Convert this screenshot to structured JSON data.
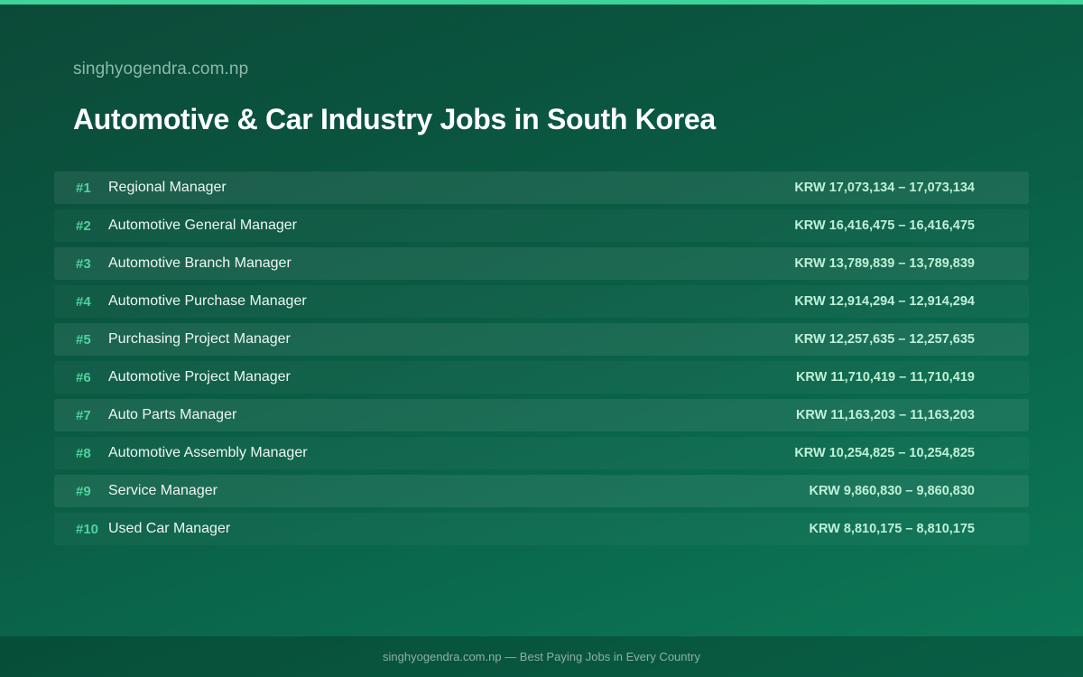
{
  "header": {
    "site": "singhyogendra.com.np",
    "title": "Automotive & Car Industry Jobs in South Korea"
  },
  "jobs": [
    {
      "rank": "#1",
      "title": "Regional Manager",
      "salary": "KRW 17,073,134 – 17,073,134"
    },
    {
      "rank": "#2",
      "title": "Automotive General Manager",
      "salary": "KRW 16,416,475 – 16,416,475"
    },
    {
      "rank": "#3",
      "title": "Automotive Branch Manager",
      "salary": "KRW 13,789,839 – 13,789,839"
    },
    {
      "rank": "#4",
      "title": "Automotive Purchase Manager",
      "salary": "KRW 12,914,294 – 12,914,294"
    },
    {
      "rank": "#5",
      "title": "Purchasing Project Manager",
      "salary": "KRW 12,257,635 – 12,257,635"
    },
    {
      "rank": "#6",
      "title": "Automotive Project Manager",
      "salary": "KRW 11,710,419 – 11,710,419"
    },
    {
      "rank": "#7",
      "title": "Auto Parts Manager",
      "salary": "KRW 11,163,203 – 11,163,203"
    },
    {
      "rank": "#8",
      "title": "Automotive Assembly Manager",
      "salary": "KRW 10,254,825 – 10,254,825"
    },
    {
      "rank": "#9",
      "title": "Service Manager",
      "salary": "KRW 9,860,830 – 9,860,830"
    },
    {
      "rank": "#10",
      "title": "Used Car Manager",
      "salary": "KRW 8,810,175 – 8,810,175"
    }
  ],
  "footer": {
    "text": "singhyogendra.com.np — Best Paying Jobs in Every Country"
  },
  "colors": {
    "accent": "#3ed39a",
    "rank": "#4fd39d",
    "salary": "#bff0d8"
  }
}
